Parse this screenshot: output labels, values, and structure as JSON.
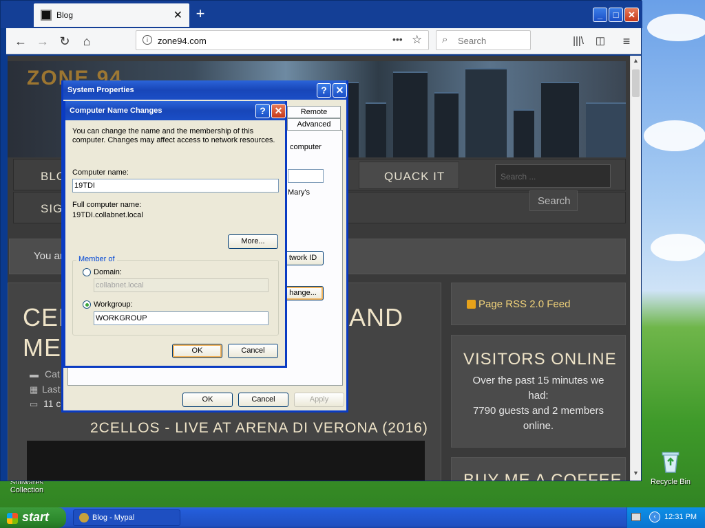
{
  "desktop": {
    "recycle_bin_label": "Recycle Bin",
    "left_icon_label_1": "Snitwares",
    "left_icon_label_2": "Collection"
  },
  "browser": {
    "tab_title": "Blog",
    "url": "zone94.com",
    "search_placeholder": "Search",
    "minimize": "_",
    "maximize": "□",
    "close": "✕"
  },
  "page": {
    "logo_text": "ZONE 94",
    "nav": {
      "blog": "BLO",
      "sign": "SIG",
      "quack": "QUACK IT",
      "search_placeholder": "Search ...",
      "search_button": "Search"
    },
    "you_are_here": "You ar",
    "article_title_line1": "CELL",
    "article_title_line1_end": "AND",
    "article_title_line2": "MET",
    "meta_category": "Cat",
    "meta_last": "Last",
    "meta_comments": "11 c",
    "video_title": "2CELLOS - LIVE AT ARENA DI VERONA (2016)",
    "rss_label": "Page RSS 2.0 Feed",
    "visitors_title": "VISITORS ONLINE",
    "visitors_text_1": "Over the past 15 minutes we",
    "visitors_text_2": "had:",
    "visitors_text_3": "7790 guests and 2 members",
    "visitors_text_4": "online.",
    "coffee_title": "BUY ME A COFFEE"
  },
  "system_properties": {
    "title": "System Properties",
    "help": "?",
    "close": "✕",
    "tab_remote": "Remote",
    "tab_advanced": "Advanced",
    "partial_computer": "computer",
    "partial_marys": "Mary's",
    "network_id_button": "twork ID",
    "change_button": "hange...",
    "ok": "OK",
    "cancel": "Cancel",
    "apply": "Apply"
  },
  "computer_name_changes": {
    "title": "Computer Name Changes",
    "help": "?",
    "close": "✕",
    "description_line1": "You can change the name and the membership of this",
    "description_line2": "computer. Changes may affect access to network resources.",
    "computer_name_label": "Computer name:",
    "computer_name_value": "19TDI",
    "full_name_label": "Full computer name:",
    "full_name_value": "19TDI.collabnet.local",
    "more_button": "More...",
    "member_of_label": "Member of",
    "domain_label": "Domain:",
    "domain_value": "collabnet.local",
    "workgroup_label": "Workgroup:",
    "workgroup_value": "WORKGROUP",
    "ok": "OK",
    "cancel": "Cancel"
  },
  "taskbar": {
    "start": "start",
    "task_label": "Blog - Mypal",
    "clock": "12:31 PM"
  }
}
